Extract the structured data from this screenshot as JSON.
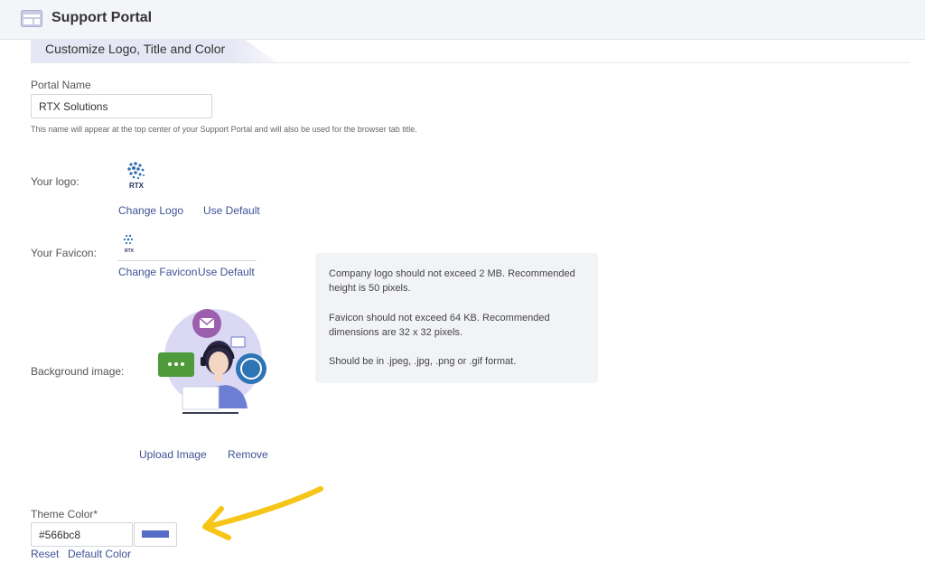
{
  "header": {
    "title": "Support Portal",
    "icon": "browser-window-icon"
  },
  "section": {
    "title": "Customize Logo, Title and Color"
  },
  "portal_name": {
    "label": "Portal Name",
    "value": "RTX Solutions",
    "help": "This name will appear at the top center of your Support Portal and will also be used for the browser tab title."
  },
  "logo": {
    "label": "Your logo:",
    "brand_text": "RTX",
    "change_label": "Change Logo",
    "default_label": "Use Default"
  },
  "favicon": {
    "label": "Your Favicon:",
    "brand_text": "RTX",
    "change_label": "Change Favicon",
    "default_label": "Use Default"
  },
  "info": {
    "line1": "Company logo should not exceed 2 MB. Recommended height is 50 pixels.",
    "line2": "Favicon should not exceed 64 KB. Recommended dimensions are 32 x 32 pixels.",
    "line3": "Should be in .jpeg, .jpg, .png or .gif format."
  },
  "background": {
    "label": "Background image:",
    "upload_label": "Upload Image",
    "remove_label": "Remove"
  },
  "theme": {
    "label": "Theme Color*",
    "value": "#566bc8",
    "reset_label": "Reset",
    "default_label": "Default Color"
  },
  "colors": {
    "accent": "#566bc8",
    "link": "#3e5295",
    "arrow": "#f5c518"
  }
}
